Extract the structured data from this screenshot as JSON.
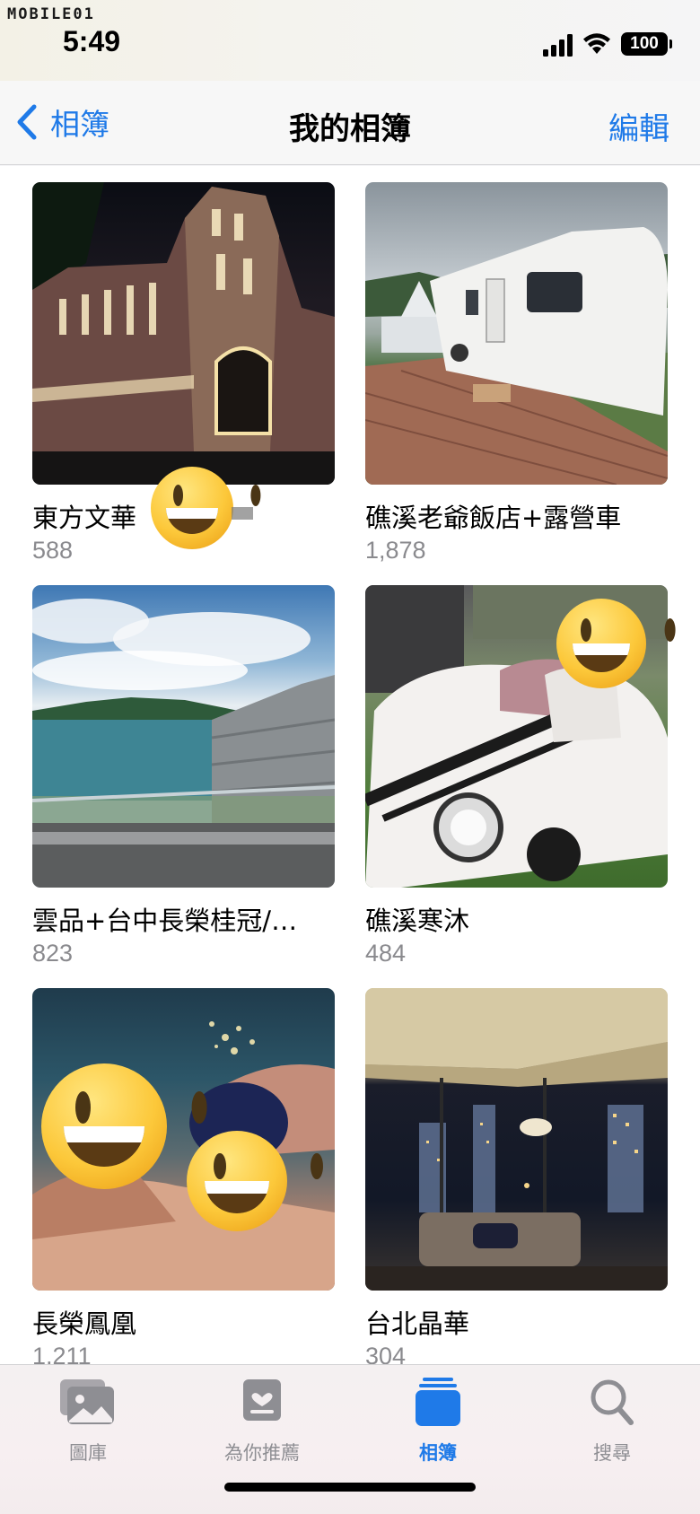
{
  "status_bar": {
    "watermark": "MOBILE01",
    "time": "5:49",
    "battery": "100"
  },
  "nav": {
    "back_label": "相簿",
    "title": "我的相簿",
    "edit_label": "編輯"
  },
  "albums": [
    {
      "title": "東方文華",
      "count": "588",
      "scene": "night-building"
    },
    {
      "title": "礁溪老爺飯店+露營車",
      "count": "1,878",
      "scene": "caravan"
    },
    {
      "title": "雲品+台中長榮桂冠/…",
      "count": "823",
      "scene": "lake-view"
    },
    {
      "title": "礁溪寒沐",
      "count": "484",
      "scene": "toy-car"
    },
    {
      "title": "長榮鳳凰",
      "count": "1,211",
      "scene": "pool"
    },
    {
      "title": "台北晶華",
      "count": "304",
      "scene": "city-night-room"
    }
  ],
  "tabs": [
    {
      "label": "圖庫",
      "icon": "library-icon",
      "active": false
    },
    {
      "label": "為你推薦",
      "icon": "for-you-icon",
      "active": false
    },
    {
      "label": "相簿",
      "icon": "albums-icon",
      "active": true
    },
    {
      "label": "搜尋",
      "icon": "search-icon",
      "active": false
    }
  ],
  "colors": {
    "accent": "#1f7ae8",
    "secondary_text": "#8a8a8e"
  }
}
